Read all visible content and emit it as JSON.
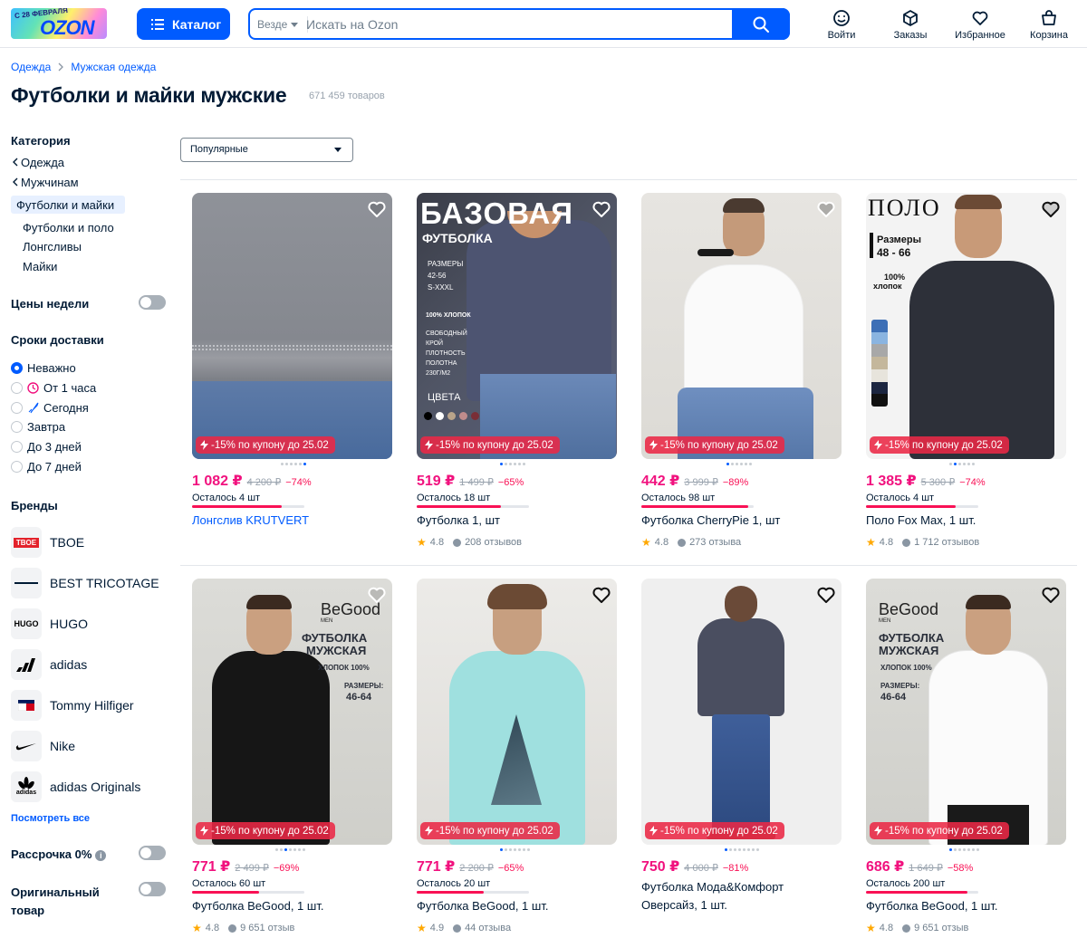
{
  "header": {
    "logo_date": "С 28 ФЕВРАЛЯ",
    "logo_text": "OZON",
    "catalog_label": "Каталог",
    "search_scope": "Везде",
    "search_placeholder": "Искать на Ozon",
    "actions": [
      {
        "label": "Войти",
        "icon": "face-icon"
      },
      {
        "label": "Заказы",
        "icon": "box-icon"
      },
      {
        "label": "Избранное",
        "icon": "heart-icon"
      },
      {
        "label": "Корзина",
        "icon": "cart-icon"
      }
    ]
  },
  "breadcrumb": [
    "Одежда",
    "Мужская одежда"
  ],
  "page": {
    "title": "Футболки и майки мужские",
    "count": "671 459 товаров"
  },
  "sidebar": {
    "category_heading": "Категория",
    "category_back": [
      "Одежда",
      "Мужчинам"
    ],
    "category_active": "Футболки и майки",
    "category_children": [
      "Футболки и поло",
      "Лонгсливы",
      "Майки"
    ],
    "week_prices": "Цены недели",
    "delivery_heading": "Сроки доставки",
    "delivery_options": [
      "Неважно",
      "От 1 часа",
      "Сегодня",
      "Завтра",
      "До 3 дней",
      "До 7 дней"
    ],
    "brands_heading": "Бренды",
    "brands": [
      {
        "name": "TBOE",
        "logo": "TBOE"
      },
      {
        "name": "BEST TRICOTAGE",
        "logo": ""
      },
      {
        "name": "HUGO",
        "logo": "HUGO"
      },
      {
        "name": "adidas",
        "logo": ""
      },
      {
        "name": "Tommy Hilfiger",
        "logo": ""
      },
      {
        "name": "Nike",
        "logo": ""
      },
      {
        "name": "adidas Originals",
        "logo": "adidas"
      }
    ],
    "see_all": "Посмотреть все",
    "installment": "Рассрочка 0%",
    "original_line1": "Оригинальный",
    "original_line2": "товар"
  },
  "sort": {
    "selected": "Популярные"
  },
  "coupon_text": "-15% по купону до 25.02",
  "products": [
    {
      "price": "1 082 ₽",
      "old_price": "4 200 ₽",
      "discount": "−74%",
      "stock": "Осталось 4 шт",
      "stock_level": 0.8,
      "title": "Лонгслив KRUTVERT",
      "rating": "",
      "reviews": ""
    },
    {
      "price": "519 ₽",
      "old_price": "1 499 ₽",
      "discount": "−65%",
      "stock": "Осталось 18 шт",
      "stock_level": 0.75,
      "title": "Футболка 1, шт",
      "rating": "4.8",
      "reviews": "208 отзывов"
    },
    {
      "price": "442 ₽",
      "old_price": "3 999 ₽",
      "discount": "−89%",
      "stock": "Осталось 98 шт",
      "stock_level": 0.95,
      "title": "Футболка CherryPie 1, шт",
      "rating": "4.8",
      "reviews": "273 отзыва"
    },
    {
      "price": "1 385 ₽",
      "old_price": "5 300 ₽",
      "discount": "−74%",
      "stock": "Осталось 4 шт",
      "stock_level": 0.8,
      "title": "Поло Fox Max, 1 шт.",
      "rating": "4.8",
      "reviews": "1 712 отзывов"
    },
    {
      "price": "771 ₽",
      "old_price": "2 499 ₽",
      "discount": "−69%",
      "stock": "Осталось 60 шт",
      "stock_level": 0.6,
      "title": "Футболка BeGood, 1 шт.",
      "rating": "4.8",
      "reviews": "9 651 отзыв"
    },
    {
      "price": "771 ₽",
      "old_price": "2 200 ₽",
      "discount": "−65%",
      "stock": "Осталось 20 шт",
      "stock_level": 0.6,
      "title": "Футболка BeGood, 1 шт.",
      "rating": "4.9",
      "reviews": "44 отзыва"
    },
    {
      "price": "750 ₽",
      "old_price": "4 000 ₽",
      "discount": "−81%",
      "stock": "",
      "stock_level": 0,
      "title": "Футболка Мода&Комфорт",
      "title2": "Оверсайз, 1 шт.",
      "rating": "",
      "reviews": ""
    },
    {
      "price": "686 ₽",
      "old_price": "1 649 ₽",
      "discount": "−58%",
      "stock": "Осталось 200 шт",
      "stock_level": 0.9,
      "title": "Футболка BeGood, 1 шт.",
      "rating": "4.8",
      "reviews": "9 651 отзыв"
    }
  ],
  "image_texts": {
    "p2_big": "БАЗОВАЯ",
    "p2_sub": "ФУТБОЛКА",
    "p2_sizes_label": "РАЗМЕРЫ",
    "p2_sizes1": "42-56",
    "p2_sizes2": "S-XXXL",
    "p2_cotton": "100% ХЛОПОК",
    "p2_f1": "СВОБОДНЫЙ",
    "p2_f2": "КРОЙ",
    "p2_f3": "ПЛОТНОСТЬ",
    "p2_f4": "ПОЛОТНА",
    "p2_f5": "230Г/М2",
    "p2_colors": "ЦВЕТА",
    "p4_big": "ПОЛО",
    "p4_sizes_label": "Размеры",
    "p4_sizes": "48 - 66",
    "p4_cotton1": "100%",
    "p4_cotton2": "хлопок",
    "begood_brand": "BeGood",
    "begood_sub": "MEN",
    "begood_t1": "ФУТБОЛКА",
    "begood_t2": "МУЖСКАЯ",
    "begood_cotton": "ХЛОПОК 100%",
    "begood_sizes_label": "РАЗМЕРЫ:",
    "begood_sizes": "46-64"
  }
}
